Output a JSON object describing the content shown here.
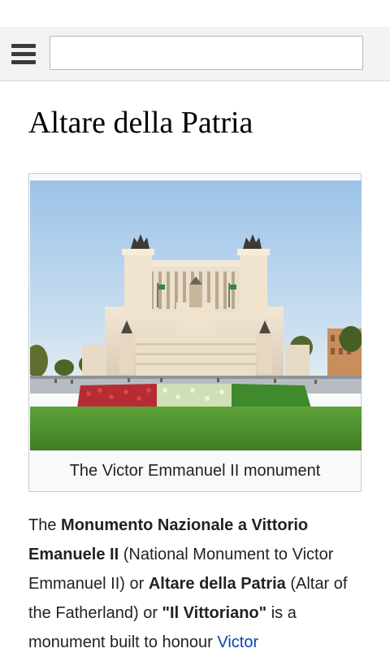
{
  "search": {
    "value": "",
    "placeholder": ""
  },
  "article": {
    "title": "Altare della Patria",
    "image_alt": "The Victor Emmanuel II monument",
    "caption": "The Victor Emmanuel II monument",
    "intro": {
      "t1": "The ",
      "b1": "Monumento Nazionale a Vittorio Emanuele II",
      "t2": " (National Monument to Victor Emmanuel II) or ",
      "b2": "Altare della Patria",
      "t3": " (Altar of the Fatherland) or ",
      "b3": "\"Il Vittoriano\"",
      "t4": " is a monument built to honour ",
      "link": "Victor"
    }
  },
  "colors": {
    "header_bg": "#f5f2f5",
    "link": "#0645ad",
    "caption_bg": "#f8f9fa",
    "text": "#222222"
  },
  "icons": {
    "menu": "hamburger-menu-icon"
  }
}
